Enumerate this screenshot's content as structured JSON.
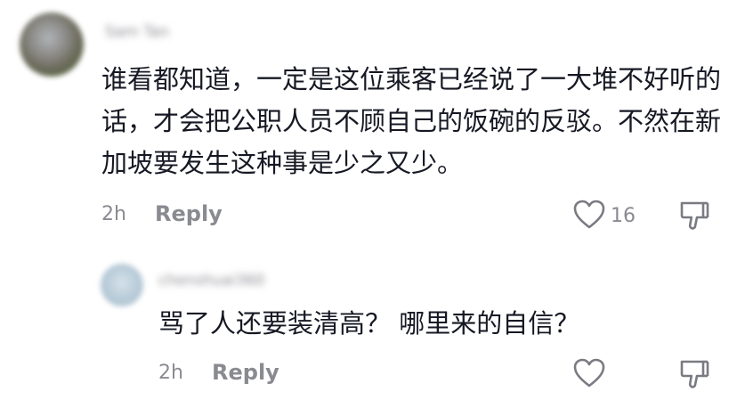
{
  "comments": [
    {
      "username": "Sam Tan",
      "text": "谁看都知道，一定是这位乘客已经说了一大堆不好听的话，才会把公职人员不顾自己的饭碗的反驳。不然在新加坡要发生这种事是少之又少。",
      "time": "2h",
      "reply_label": "Reply",
      "like_count": "16"
    },
    {
      "username": "chenshuai360",
      "text": "骂了人还要装清高？ 哪里来的自信？",
      "time": "2h",
      "reply_label": "Reply",
      "like_count": ""
    }
  ],
  "icons": {
    "like": "heart-outline-icon",
    "dislike": "thumbs-down-outline-icon"
  }
}
